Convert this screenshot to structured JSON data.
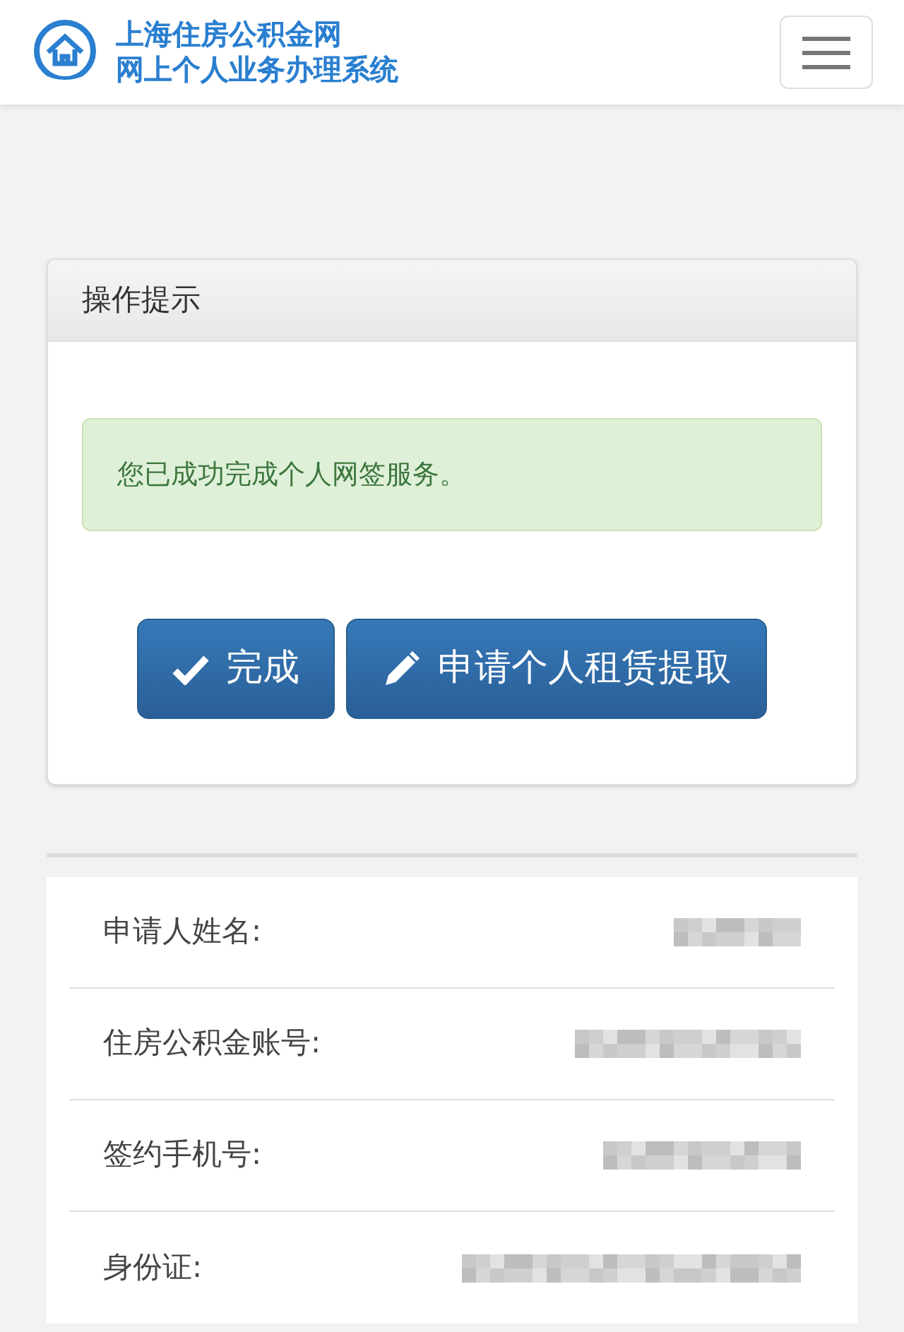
{
  "header": {
    "title_line_1": "上海住房公积金网",
    "title_line_2": "网上个人业务办理系统"
  },
  "panel": {
    "heading": "操作提示",
    "alert": "您已成功完成个人网签服务。",
    "buttons": [
      {
        "kind": "check",
        "label": "完成"
      },
      {
        "kind": "pencil",
        "label": "申请个人租赁提取"
      }
    ]
  },
  "details": [
    {
      "label": "申请人姓名:",
      "kind": "pixelated"
    },
    {
      "label": "住房公积金账号:",
      "kind": "pixelated"
    },
    {
      "label": "签约手机号:",
      "kind": "pixelated"
    },
    {
      "label": "身份证:",
      "kind": "pixelated"
    }
  ]
}
